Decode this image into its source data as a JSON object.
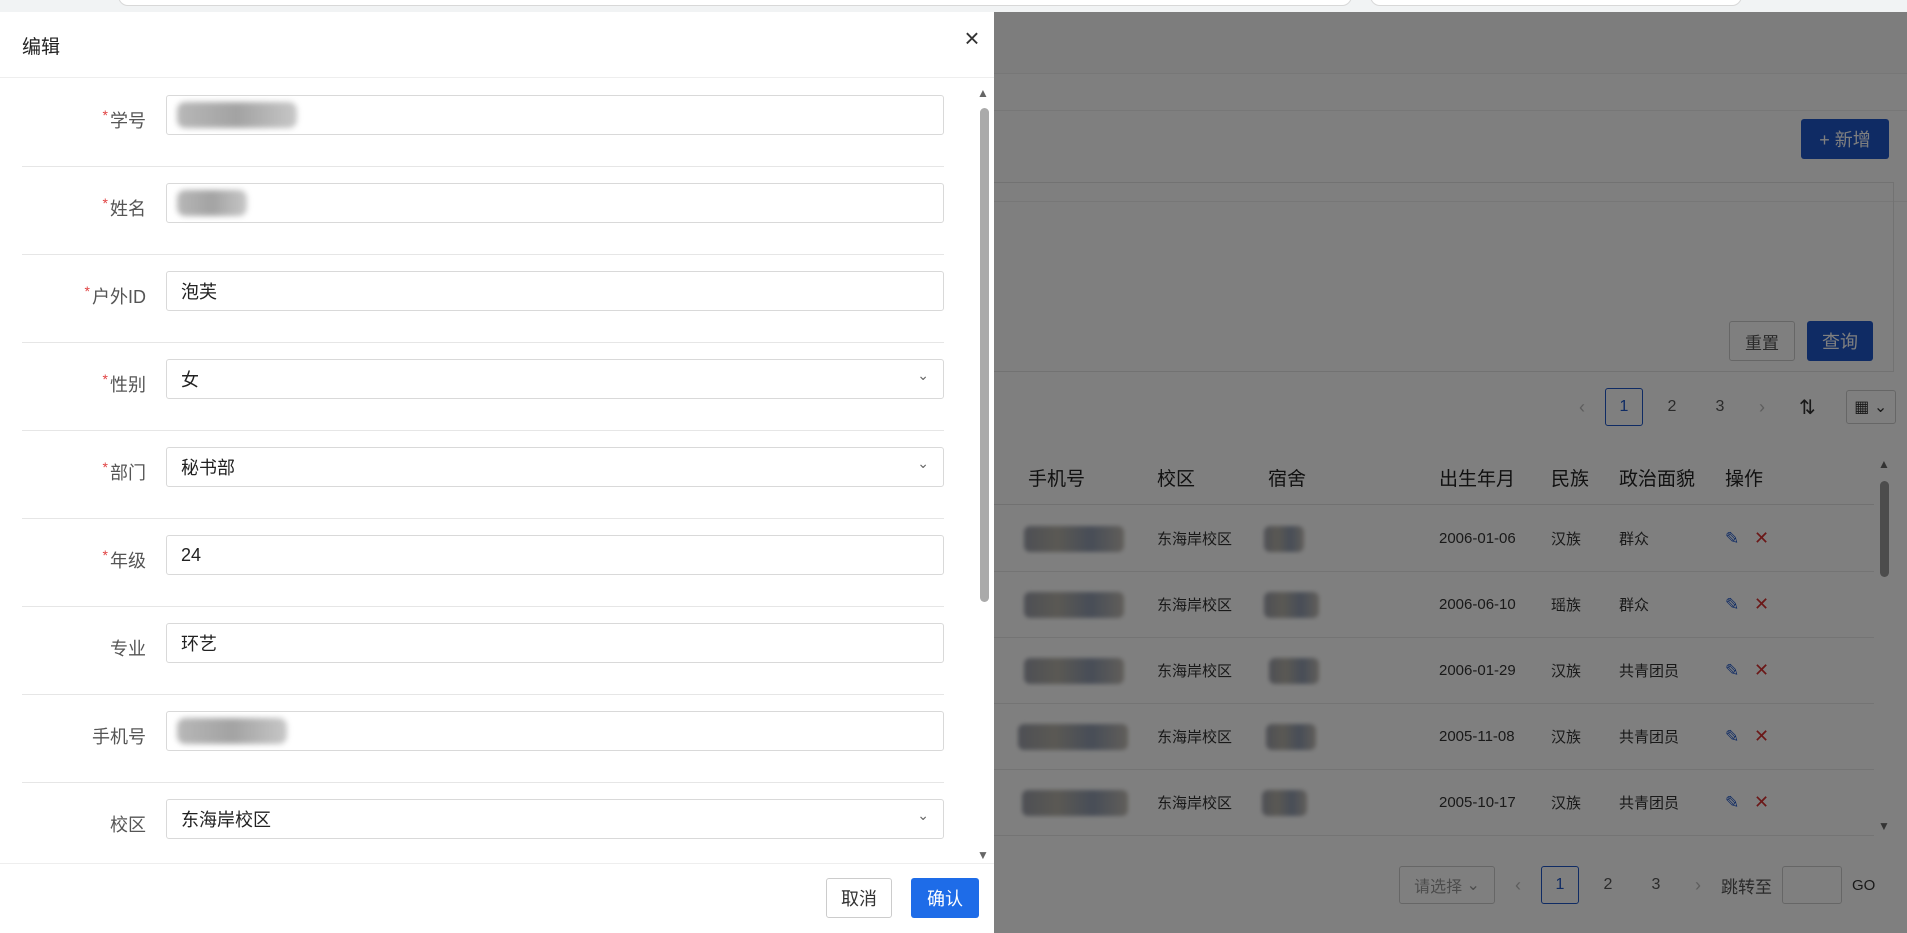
{
  "drawer": {
    "title": "编辑",
    "close_icon": "close-icon",
    "fields": [
      {
        "label": "学号",
        "required": true,
        "value": "",
        "type": "text",
        "masked": true
      },
      {
        "label": "姓名",
        "required": true,
        "value": "",
        "type": "text",
        "masked": true
      },
      {
        "label": "户外ID",
        "required": true,
        "value": "泡芙",
        "type": "text",
        "masked": false
      },
      {
        "label": "性别",
        "required": true,
        "value": "女",
        "type": "select",
        "masked": false
      },
      {
        "label": "部门",
        "required": true,
        "value": "秘书部",
        "type": "select",
        "masked": false
      },
      {
        "label": "年级",
        "required": true,
        "value": "24",
        "type": "text",
        "masked": false
      },
      {
        "label": "专业",
        "required": false,
        "value": "环艺",
        "type": "text",
        "masked": false
      },
      {
        "label": "手机号",
        "required": false,
        "value": "",
        "type": "text",
        "masked": true
      },
      {
        "label": "校区",
        "required": false,
        "value": "东海岸校区",
        "type": "select",
        "masked": false
      }
    ],
    "footer": {
      "cancel_label": "取消",
      "ok_label": "确认"
    }
  },
  "background": {
    "add_button": "+ 新增",
    "reset_button": "重置",
    "query_button": "查询",
    "top_pager": {
      "pages": [
        "1",
        "2",
        "3"
      ],
      "current": "1"
    },
    "table": {
      "headers": [
        "手机号",
        "校区",
        "宿舍",
        "出生年月",
        "民族",
        "政治面貌",
        "操作"
      ],
      "rows": [
        {
          "campus": "东海岸校区",
          "birth": "2006-01-06",
          "ethnic": "汉族",
          "political": "群众"
        },
        {
          "campus": "东海岸校区",
          "birth": "2006-06-10",
          "ethnic": "瑶族",
          "political": "群众"
        },
        {
          "campus": "东海岸校区",
          "birth": "2006-01-29",
          "ethnic": "汉族",
          "political": "共青团员"
        },
        {
          "campus": "东海岸校区",
          "birth": "2005-11-08",
          "ethnic": "汉族",
          "political": "共青团员"
        },
        {
          "campus": "东海岸校区",
          "birth": "2005-10-17",
          "ethnic": "汉族",
          "political": "共青团员"
        }
      ]
    },
    "bottom_pager": {
      "select_placeholder": "请选择",
      "pages": [
        "1",
        "2",
        "3"
      ],
      "current": "1",
      "jump_label": "跳转至",
      "go_label": "GO"
    }
  }
}
